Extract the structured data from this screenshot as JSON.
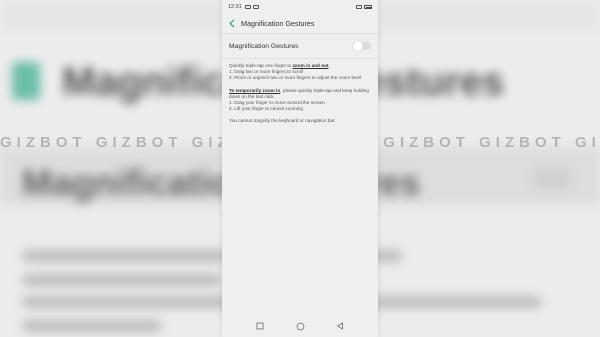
{
  "status_bar": {
    "time": "12:31"
  },
  "header": {
    "title": "Magnification Gestures"
  },
  "setting": {
    "label": "Magnification Gestures",
    "enabled": false
  },
  "description": {
    "p1_intro": "Quickly triple-tap one finger to ",
    "p1_emph": "zoom in and out",
    "p1_end": ".",
    "p1_line1": "1. Drag two or more fingers to scroll",
    "p1_line2": "2. Pinch or unpinch two or more fingers to adjust the zoom level",
    "p2_emph": "To temporarily zoom in",
    "p2_rest": ", please quickly triple-tap and keep holding down on the last click.",
    "p2_line1": "1. Drag your finger to move around the screen",
    "p2_line2": "2. Lift your finger to cancel zooming",
    "p3": "You cannot magnify the keyboard or navigation bar."
  },
  "watermark": {
    "text": "GIZBOT GIZBOT GIZBOT GIZBOT GIZBOT GIZBOT GIZBOT GIZBOT"
  },
  "background": {
    "title": "Magnification Gestures",
    "subtitle": "Magnification Gestures"
  },
  "colors": {
    "accent": "#2ea88a",
    "background": "#efefef"
  },
  "icons": {
    "back": "chevron-left-icon",
    "nav_recent": "square-icon",
    "nav_home": "circle-icon",
    "nav_back": "triangle-icon"
  }
}
